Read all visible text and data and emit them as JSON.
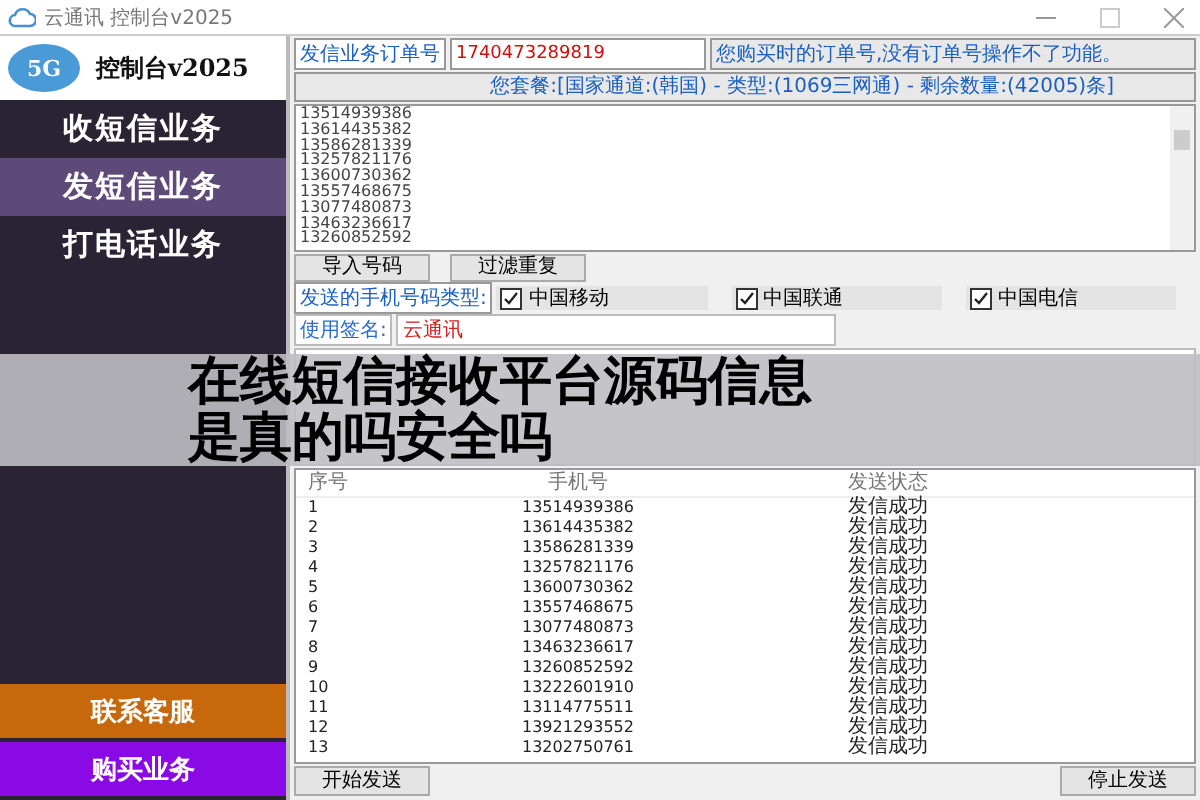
{
  "window": {
    "title": "云通讯 控制台v2025"
  },
  "sidebar": {
    "logo_badge": "5G",
    "logo_text": "控制台v2025",
    "items": [
      {
        "label": "收短信业务",
        "selected": false
      },
      {
        "label": "发短信业务",
        "selected": true
      },
      {
        "label": "打电话业务",
        "selected": false
      }
    ],
    "bottom_items": [
      {
        "label": "联系客服",
        "color": "#c8680c"
      },
      {
        "label": "购买业务",
        "color": "#8a0ae6"
      }
    ]
  },
  "order": {
    "label": "发信业务订单号",
    "value": "1740473289819",
    "hint": "您购买时的订单号,没有订单号操作不了功能。"
  },
  "package_info": "您套餐:[国家通道:(韩国) - 类型:(1069三网通) - 剩余数量:(42005)条]",
  "numbers_box": {
    "lines": [
      "13514939386",
      "13614435382",
      "13586281339",
      "13257821176",
      "13600730362",
      "13557468675",
      "13077480873",
      "13463236617",
      "13260852592"
    ]
  },
  "tool_buttons": [
    "导入号码",
    "过滤重复"
  ],
  "carrier": {
    "label": "发送的手机号码类型:",
    "options": [
      {
        "label": "中国移动",
        "checked": true
      },
      {
        "label": "中国联通",
        "checked": true
      },
      {
        "label": "中国电信",
        "checked": true
      }
    ]
  },
  "signature": {
    "label": "使用签名:",
    "value": "云通讯"
  },
  "table": {
    "columns": [
      "序号",
      "手机号",
      "发送状态"
    ],
    "rows": [
      [
        "1",
        "13514939386",
        "发信成功"
      ],
      [
        "2",
        "13614435382",
        "发信成功"
      ],
      [
        "3",
        "13586281339",
        "发信成功"
      ],
      [
        "4",
        "13257821176",
        "发信成功"
      ],
      [
        "5",
        "13600730362",
        "发信成功"
      ],
      [
        "6",
        "13557468675",
        "发信成功"
      ],
      [
        "7",
        "13077480873",
        "发信成功"
      ],
      [
        "8",
        "13463236617",
        "发信成功"
      ],
      [
        "9",
        "13260852592",
        "发信成功"
      ],
      [
        "10",
        "13222601910",
        "发信成功"
      ],
      [
        "11",
        "13114775511",
        "发信成功"
      ],
      [
        "12",
        "13921293552",
        "发信成功"
      ],
      [
        "13",
        "13202750761",
        "发信成功"
      ]
    ]
  },
  "send_buttons": [
    "开始发送",
    "停止发送"
  ],
  "overlay_title": {
    "lines": [
      "在线短信接收平台源码信息",
      "是真的吗安全吗"
    ]
  }
}
